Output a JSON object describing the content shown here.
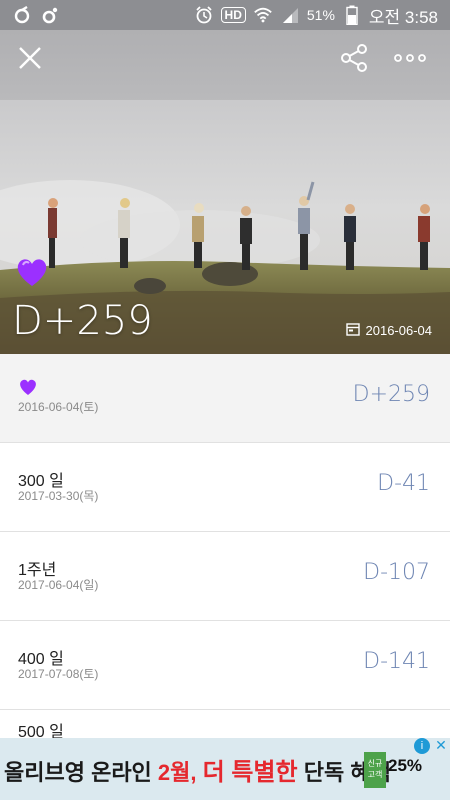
{
  "status_bar": {
    "battery": "51%",
    "time": "오전 3:58",
    "hd_label": "HD"
  },
  "header": {
    "dday": "D+259",
    "date": "2016-06-04",
    "icons": [
      "close-icon",
      "share-icon",
      "more-icon"
    ]
  },
  "list": [
    {
      "title": "",
      "heart": true,
      "date": "2016-06-04(토)",
      "dday": "D+259"
    },
    {
      "title": "300 일",
      "heart": false,
      "date": "2017-03-30(목)",
      "dday": "D-41"
    },
    {
      "title": "1주년",
      "heart": false,
      "date": "2017-06-04(일)",
      "dday": "D-107"
    },
    {
      "title": "400 일",
      "heart": false,
      "date": "2017-07-08(토)",
      "dday": "D-141"
    },
    {
      "title": "500 일"
    }
  ],
  "ad": {
    "text_part1": "올리브영 온라인 ",
    "text_part2": "2월, ",
    "text_part3": "더 특별한",
    "text_part4": " 단독 혜택",
    "badge": "신규 고객",
    "percent": "25%",
    "info_label": "i",
    "close_label": "✕"
  },
  "colors": {
    "accent_dday": "#6f86b3",
    "heart": "#9b30ff",
    "statusbar": "#8d8e92"
  }
}
